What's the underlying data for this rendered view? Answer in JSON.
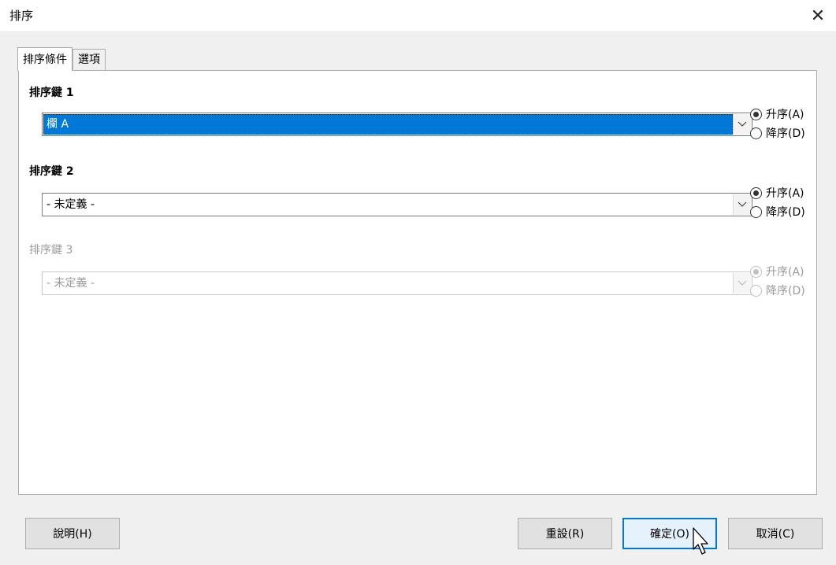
{
  "window": {
    "title": "排序",
    "close_glyph": "✕"
  },
  "tabs": [
    {
      "label": "排序條件",
      "active": true
    },
    {
      "label": "選項",
      "active": false
    }
  ],
  "sort_keys": [
    {
      "label": "排序鍵 1",
      "value": "欄 A",
      "ascending_label": "升序(A)",
      "descending_label": "降序(D)",
      "selected_order": "ascending",
      "enabled": true
    },
    {
      "label": "排序鍵 2",
      "value": "- 未定義 -",
      "ascending_label": "升序(A)",
      "descending_label": "降序(D)",
      "selected_order": "ascending",
      "enabled": true
    },
    {
      "label": "排序鍵 3",
      "value": "- 未定義 -",
      "ascending_label": "升序(A)",
      "descending_label": "降序(D)",
      "selected_order": "ascending",
      "enabled": false
    }
  ],
  "buttons": {
    "help": "說明(H)",
    "reset": "重設(R)",
    "ok": "確定(O)",
    "cancel": "取消(C)"
  },
  "colors": {
    "selection": "#0078d7",
    "default_button_border": "#0078d7"
  }
}
